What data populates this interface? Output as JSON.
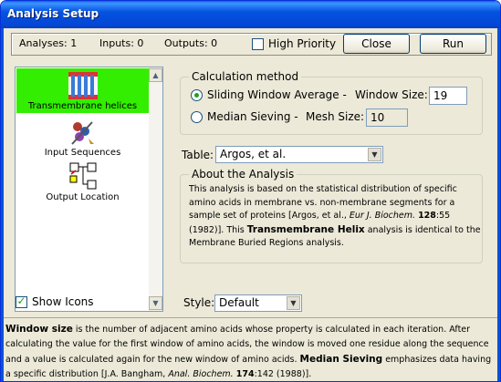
{
  "window": {
    "title": "Analysis Setup"
  },
  "stats": {
    "analyses": "Analyses: 1",
    "inputs": "Inputs: 0",
    "outputs": "Outputs: 0"
  },
  "toolbar": {
    "high_priority_label": "High Priority",
    "high_priority_checked": false,
    "close_label": "Close",
    "run_label": "Run"
  },
  "sidebar": {
    "items": [
      {
        "label": "Transmembrane helices",
        "icon": "transmembrane-helices-icon",
        "selected": true
      },
      {
        "label": "Input Sequences",
        "icon": "input-sequences-icon",
        "selected": false
      },
      {
        "label": "Output Location",
        "icon": "output-location-icon",
        "selected": false
      }
    ],
    "show_icons_label": "Show Icons",
    "show_icons_checked": true
  },
  "calculation": {
    "title": "Calculation method",
    "sliding_label": "Sliding Window Average -",
    "window_size_label": "Window Size:",
    "window_size_value": "19",
    "median_label": "Median Sieving -",
    "mesh_size_label": "Mesh Size:",
    "mesh_size_value": "10",
    "selected": "sliding"
  },
  "table": {
    "label": "Table:",
    "value": "Argos, et al."
  },
  "about": {
    "title": "About the Analysis",
    "text_1": "This analysis is based on the statistical distribution of specific amino acids in membrane vs. non-membrane segments for a sample set of proteins [Argos, et al., ",
    "journal": "Eur J. Biochem.",
    "volume": "128",
    "text_2": ":55 (1982)]. This ",
    "bold_name": "Transmembrane Helix",
    "text_3": " analysis is identical to the Membrane Buried Regions analysis."
  },
  "style": {
    "label": "Style:",
    "value": "Default"
  },
  "help": {
    "bold_1": "Window size",
    "text_1": " is the number of adjacent amino acids whose property is calculated in each iteration. After calculating the value for the first window of amino acids, the window is moved one residue along the sequence and a value is calculated again for the new window of amino acids. ",
    "bold_2": "Median Sieving",
    "text_2": " emphasizes data having a specific distribution [J.A. Bangham, ",
    "journal": "Anal. Biochem.",
    "volume": "174",
    "text_3": ":142 (1988)]."
  },
  "colors": {
    "title_bar": "#0553e0",
    "selected_item": "#33ee00",
    "checkmark": "#21a121"
  }
}
